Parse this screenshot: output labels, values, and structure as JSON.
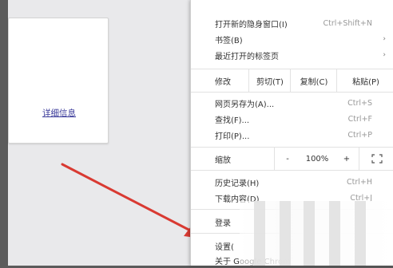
{
  "page": {
    "details_link": "详细信息"
  },
  "menu": {
    "incognito": {
      "label": "打开新的隐身窗口(I)",
      "shortcut": "Ctrl+Shift+N"
    },
    "bookmarks": {
      "label": "书签(B)",
      "submenu_glyph": "›"
    },
    "recent_tabs": {
      "label": "最近打开的标签页",
      "submenu_glyph": "›"
    },
    "edit": {
      "label": "修改",
      "cut": "剪切(T)",
      "copy": "复制(C)",
      "paste": "粘贴(P)"
    },
    "save_page": {
      "label": "网页另存为(A)...",
      "shortcut": "Ctrl+S"
    },
    "find": {
      "label": "查找(F)...",
      "shortcut": "Ctrl+F"
    },
    "print": {
      "label": "打印(P)...",
      "shortcut": "Ctrl+P"
    },
    "zoom": {
      "label": "缩放",
      "minus": "-",
      "level": "100%",
      "plus": "+",
      "fullscreen_icon": "fullscreen-icon"
    },
    "history": {
      "label": "历史记录(H)",
      "shortcut": "Ctrl+H"
    },
    "downloads": {
      "label": "下载内容(D)",
      "shortcut": "Ctrl+J"
    },
    "sign_in": {
      "label": "登录"
    },
    "settings": {
      "label": "设置("
    },
    "about": {
      "label": "关于 Google Chrom"
    }
  },
  "colors": {
    "arrow": "#d93a32",
    "link": "#3b3b9a",
    "shortcut": "#999999"
  }
}
